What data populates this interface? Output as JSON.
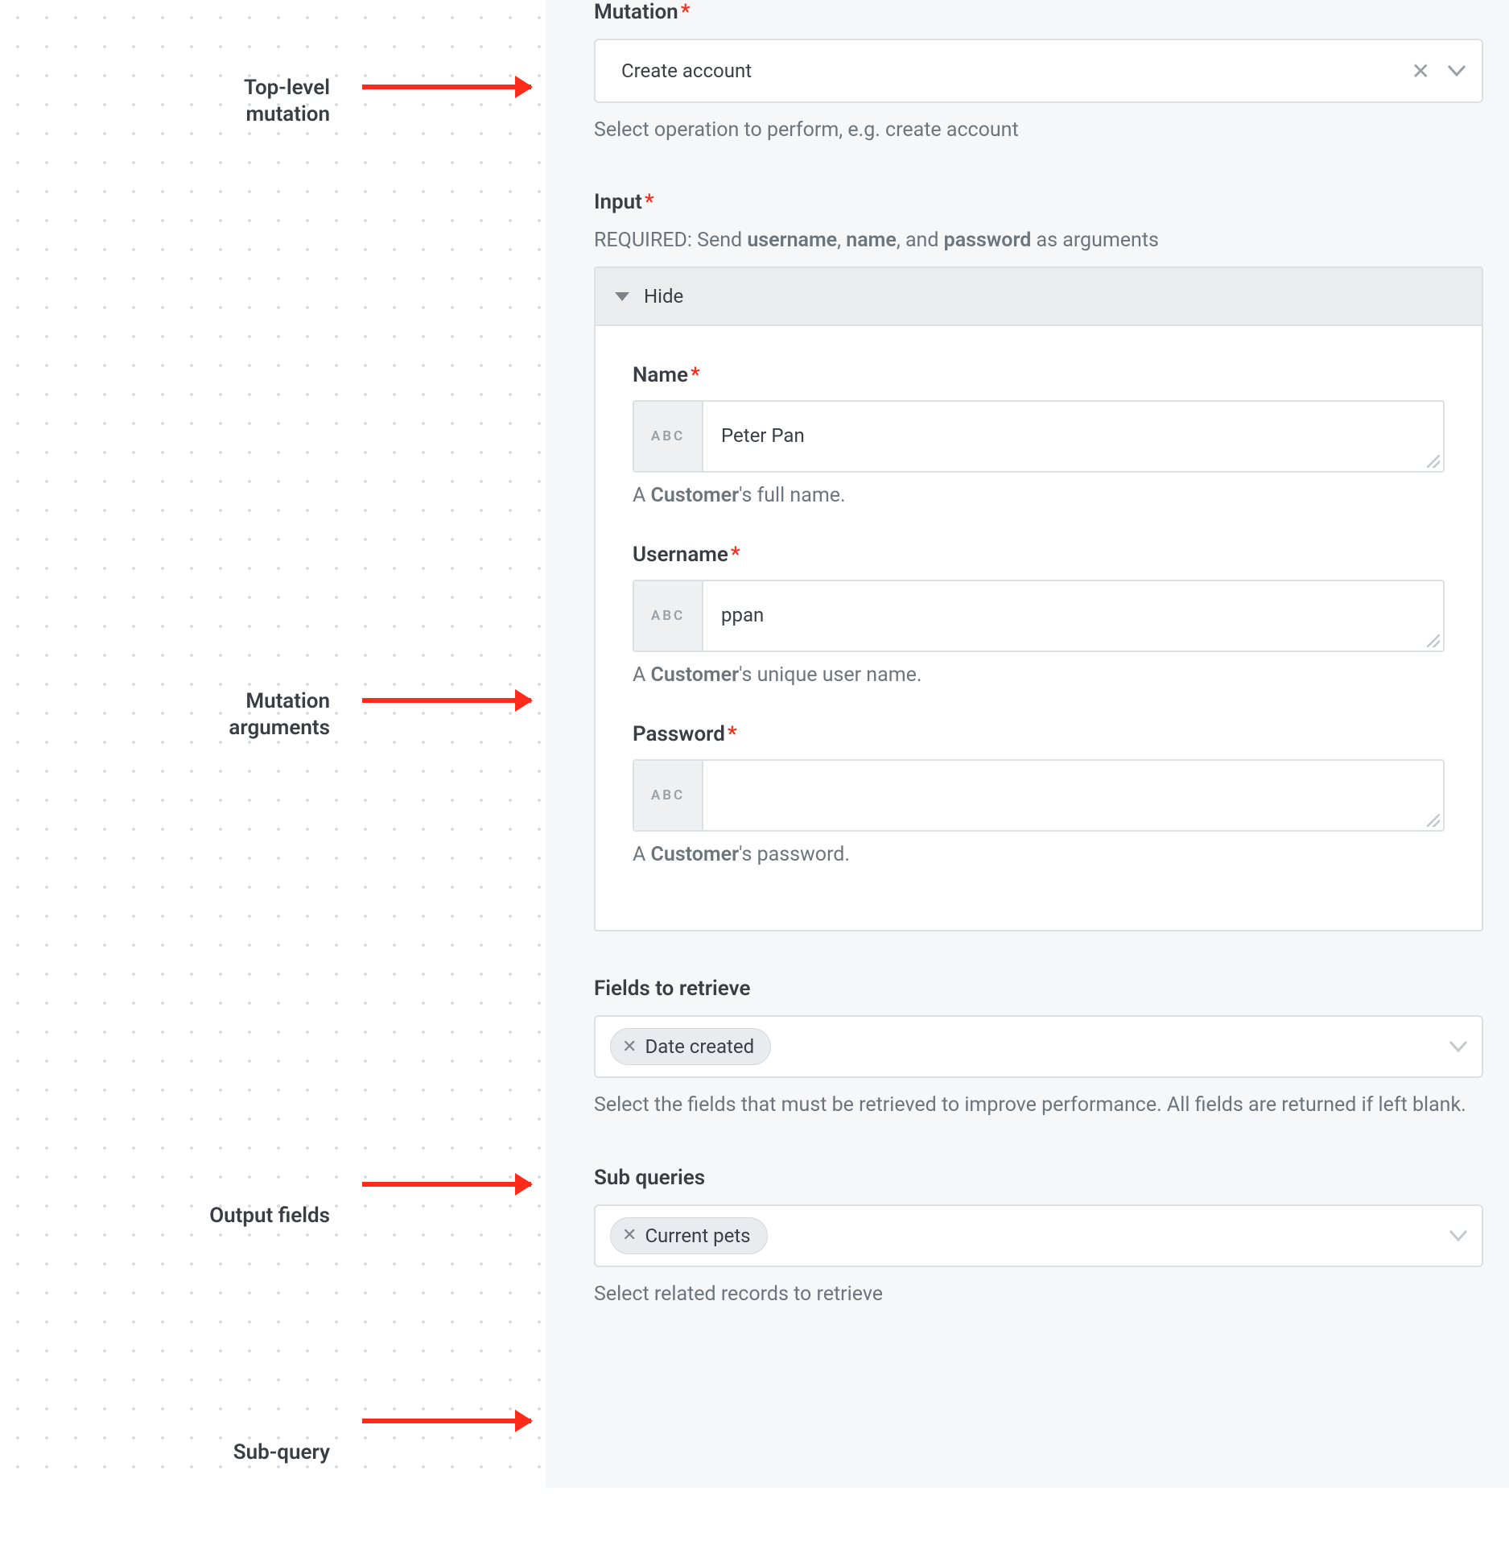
{
  "annotations": {
    "top_level_mutation": "Top-level\nmutation",
    "mutation_arguments": "Mutation\narguments",
    "output_fields": "Output fields",
    "sub_query": "Sub-query"
  },
  "mutation": {
    "label": "Mutation",
    "value": "Create account",
    "hint": "Select operation to perform, e.g. create account"
  },
  "input": {
    "label": "Input",
    "required_prefix": "REQUIRED: Send ",
    "req_username": "username",
    "req_sep1": ", ",
    "req_name": "name",
    "req_sep2": ", and ",
    "req_password": "password",
    "required_suffix": " as arguments",
    "hide_label": "Hide",
    "name": {
      "label": "Name",
      "value": "Peter Pan",
      "chip": "ABC",
      "hint_pre": "A ",
      "hint_strong": "Customer",
      "hint_post": "'s full name."
    },
    "username": {
      "label": "Username",
      "value": "ppan",
      "chip": "ABC",
      "hint_pre": "A ",
      "hint_strong": "Customer",
      "hint_post": "'s unique user name."
    },
    "password": {
      "label": "Password",
      "value": "",
      "chip": "ABC",
      "hint_pre": "A ",
      "hint_strong": "Customer",
      "hint_post": "'s password."
    }
  },
  "fields_to_retrieve": {
    "label": "Fields to retrieve",
    "pill": "Date created",
    "hint": "Select the fields that must be retrieved to improve performance. All fields are returned if left blank."
  },
  "sub_queries": {
    "label": "Sub queries",
    "pill": "Current pets",
    "hint": "Select related records to retrieve"
  }
}
